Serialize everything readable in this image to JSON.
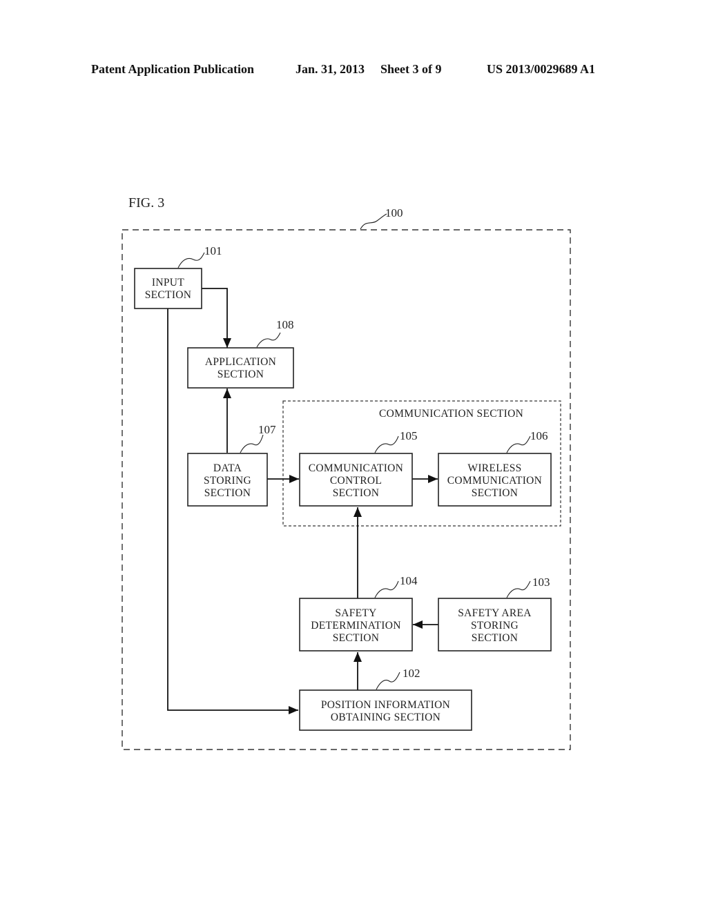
{
  "header": {
    "publication": "Patent Application Publication",
    "date": "Jan. 31, 2013",
    "sheet": "Sheet 3 of 9",
    "number": "US 2013/0029689 A1"
  },
  "figure": {
    "label": "FIG. 3",
    "device_ref": "100",
    "group": {
      "label": "COMMUNICATION SECTION"
    },
    "blocks": {
      "input": {
        "ref": "101",
        "lines": [
          "INPUT",
          "SECTION"
        ]
      },
      "application": {
        "ref": "108",
        "lines": [
          "APPLICATION",
          "SECTION"
        ]
      },
      "data_storing": {
        "ref": "107",
        "lines": [
          "DATA",
          "STORING",
          "SECTION"
        ]
      },
      "comm_control": {
        "ref": "105",
        "lines": [
          "COMMUNICATION",
          "CONTROL",
          "SECTION"
        ]
      },
      "wireless": {
        "ref": "106",
        "lines": [
          "WIRELESS",
          "COMMUNICATION",
          "SECTION"
        ]
      },
      "safety_det": {
        "ref": "104",
        "lines": [
          "SAFETY",
          "DETERMINATION",
          "SECTION"
        ]
      },
      "safety_area": {
        "ref": "103",
        "lines": [
          "SAFETY AREA",
          "STORING",
          "SECTION"
        ]
      },
      "position": {
        "ref": "102",
        "lines": [
          "POSITION INFORMATION",
          "OBTAINING SECTION"
        ]
      }
    },
    "connections": [
      {
        "from": "input",
        "to": "application"
      },
      {
        "from": "input",
        "to": "position"
      },
      {
        "from": "data_storing",
        "to": "application"
      },
      {
        "from": "data_storing",
        "to": "comm_control"
      },
      {
        "from": "comm_control",
        "to": "wireless"
      },
      {
        "from": "safety_det",
        "to": "comm_control"
      },
      {
        "from": "safety_area",
        "to": "safety_det"
      },
      {
        "from": "position",
        "to": "safety_det"
      }
    ]
  }
}
